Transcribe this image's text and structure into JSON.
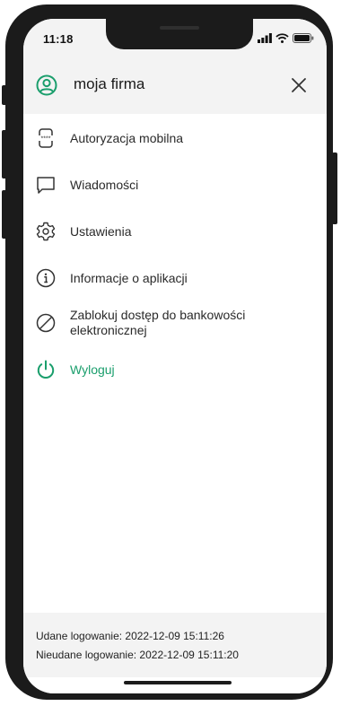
{
  "status_bar": {
    "time": "11:18"
  },
  "header": {
    "company_name": "moja firma",
    "icons": {
      "user": "user-circle-icon",
      "close": "close-icon"
    }
  },
  "menu": {
    "items": [
      {
        "label": "Autoryzacja mobilna",
        "icon": "mobile-authorization-icon"
      },
      {
        "label": "Wiadomości",
        "icon": "message-icon"
      },
      {
        "label": "Ustawienia",
        "icon": "settings-icon"
      },
      {
        "label": "Informacje o aplikacji",
        "icon": "info-icon"
      },
      {
        "label": "Zablokuj dostęp do bankowości elektronicznej",
        "icon": "block-icon"
      },
      {
        "label": "Wyloguj",
        "icon": "power-icon"
      }
    ]
  },
  "footer": {
    "last_success": "Udane logowanie: 2022-12-09 15:11:26",
    "last_failure": "Nieudane logowanie: 2022-12-09 15:11:20"
  },
  "colors": {
    "accent": "#1a9e6c",
    "panel_gray": "#f3f3f3",
    "frame": "#1b1b1b"
  }
}
